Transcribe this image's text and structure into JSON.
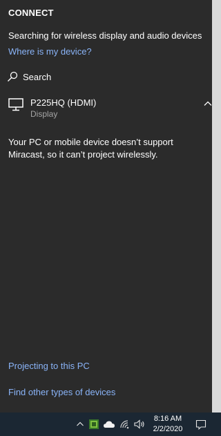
{
  "panel": {
    "title": "CONNECT",
    "status": "Searching for wireless display and audio devices",
    "where_link": "Where is my device?",
    "search_label": "Search",
    "device": {
      "name": "P225HQ (HDMI)",
      "type": "Display"
    },
    "message": "Your PC or mobile device doesn’t support Miracast, so it can’t project wirelessly.",
    "projecting_link": "Projecting to this PC",
    "find_link": "Find other types of devices"
  },
  "taskbar": {
    "time": "8:16 AM",
    "date": "2/2/2020",
    "icons": [
      "chevron-up-icon",
      "app-icon",
      "cloud-icon",
      "wifi-icon",
      "speaker-icon",
      "notification-icon"
    ]
  },
  "colors": {
    "panel_bg": "#2b2b2b",
    "link": "#8ab4f8",
    "taskbar_bg": "#1b2733"
  }
}
